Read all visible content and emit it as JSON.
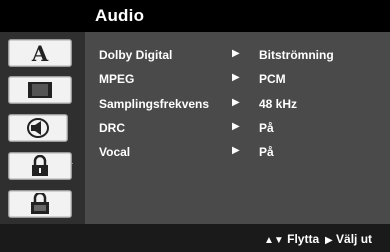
{
  "title": "Audio",
  "sidebar": {
    "icons": [
      "language-icon",
      "display-icon",
      "audio-icon",
      "lock-icon",
      "other-settings-icon"
    ],
    "active_index": 2
  },
  "settings": [
    {
      "label": "Dolby Digital",
      "value": "Bitströmning"
    },
    {
      "label": "MPEG",
      "value": "PCM"
    },
    {
      "label": "Samplingsfrekvens",
      "value": "48 kHz"
    },
    {
      "label": "DRC",
      "value": "På"
    },
    {
      "label": "Vocal",
      "value": "På"
    }
  ],
  "footer": {
    "move_label": "Flytta",
    "select_label": "Välj ut"
  }
}
